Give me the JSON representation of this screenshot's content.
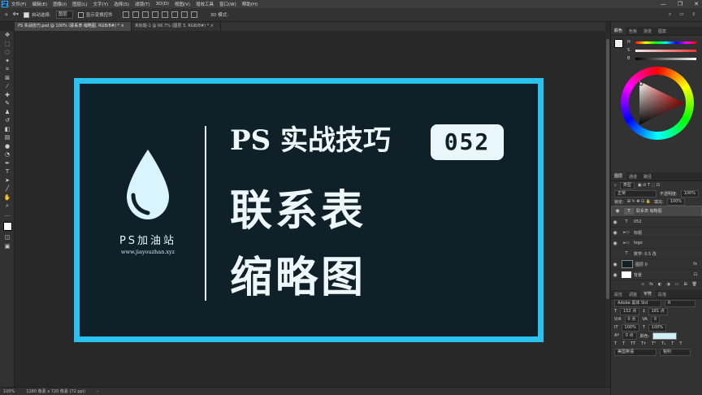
{
  "menu": {
    "logo": "Ps",
    "items": [
      "文件(F)",
      "编辑(E)",
      "图像(I)",
      "图层(L)",
      "文字(Y)",
      "选择(S)",
      "滤镜(T)",
      "3D(D)",
      "视图(V)",
      "增效工具",
      "窗口(W)",
      "帮助(H)"
    ],
    "window_controls": [
      "—",
      "❐",
      "✕"
    ]
  },
  "options": {
    "auto_select_label": "自动选择:",
    "auto_select_value": "图层",
    "show_transform_label": "显示变换控件",
    "mode_3d_label": "3D 模式:"
  },
  "tabs": [
    {
      "label": "PS 实战技巧.psd @ 100% (联系表 缩略图, RGB/8#) *",
      "close": "×"
    },
    {
      "label": "未标题-1 @ 66.7% (图层 3, RGB/8#) *",
      "close": "×"
    }
  ],
  "tools": [
    "move",
    "marquee",
    "lasso",
    "magic-wand",
    "crop",
    "frame",
    "eyedropper",
    "healing",
    "brush",
    "stamp",
    "history-brush",
    "eraser",
    "gradient",
    "blur",
    "dodge",
    "pen",
    "type",
    "path-select",
    "shape",
    "hand",
    "zoom",
    "more",
    "colors",
    "quickmask",
    "screenmode"
  ],
  "artwork": {
    "brand": "PS加油站",
    "site": "www.jiayouzhan.xyz",
    "title1": "PS 实战技巧",
    "badge": "052",
    "title2": "联系表",
    "title3": "缩略图",
    "colors": {
      "frame": "#29c2ef",
      "background": "#102029",
      "text": "#eef8fb"
    }
  },
  "status": {
    "zoom": "100%",
    "doc": "1280 像素 x 720 像素 (72 ppi)"
  },
  "color_panel": {
    "tabs": [
      "颜色",
      "色板",
      "渐变",
      "图案"
    ],
    "sliders": [
      {
        "label": "H",
        "value": "0"
      },
      {
        "label": "S",
        "value": "0"
      },
      {
        "label": "B",
        "value": "94"
      }
    ]
  },
  "layers_panel": {
    "tabs": [
      "图层",
      "通道",
      "路径"
    ],
    "filter_label": "类型",
    "blend_mode": "正常",
    "opacity_label": "不透明度:",
    "opacity_value": "100%",
    "lock_label": "锁定:",
    "fill_label": "填充:",
    "fill_value": "100%",
    "layers": [
      {
        "name": "联系表 缩略图",
        "type": "T",
        "selected": true
      },
      {
        "name": "052",
        "type": "T",
        "selected": false
      },
      {
        "name": "标题",
        "type": "folder",
        "selected": false
      },
      {
        "name": "logo",
        "type": "folder",
        "selected": false
      },
      {
        "name": "数学: 0.5 改",
        "type": "T",
        "selected": false
      },
      {
        "name": "图层 0",
        "type": "pixel",
        "selected": false
      },
      {
        "name": "背景",
        "type": "pixel",
        "selected": false
      }
    ]
  },
  "character_panel": {
    "tabs": [
      "属性",
      "调整",
      "字符",
      "段落"
    ],
    "font_family": "Adobe 黑体 Std",
    "font_style": "R",
    "font_size": "152 点",
    "leading": "181 点",
    "kerning": "0 点",
    "tracking": "0",
    "scale_v": "100%",
    "scale_h": "100%",
    "baseline": "0 点",
    "color_label": "颜色:",
    "language": "美国英语",
    "antialias": "锐利"
  }
}
